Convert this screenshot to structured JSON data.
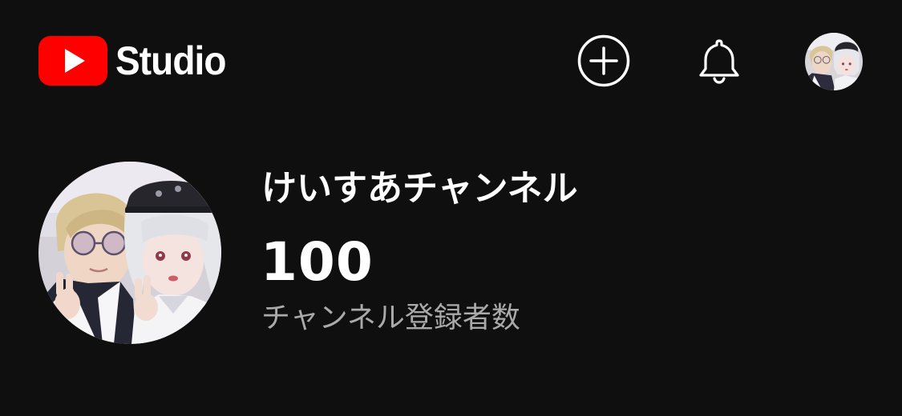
{
  "header": {
    "brand_text": "Studio",
    "logo_icon": "youtube-play-icon",
    "create_icon": "plus-circle-icon",
    "notifications_icon": "bell-icon",
    "account_avatar": "account-avatar"
  },
  "channel": {
    "name": "けいすあチャンネル",
    "subscriber_count": "100",
    "subscriber_label": "チャンネル登録者数"
  },
  "colors": {
    "background": "#0f0f0f",
    "youtube_red": "#ff0000",
    "text_primary": "#ffffff",
    "text_secondary": "#aaaaaa"
  }
}
